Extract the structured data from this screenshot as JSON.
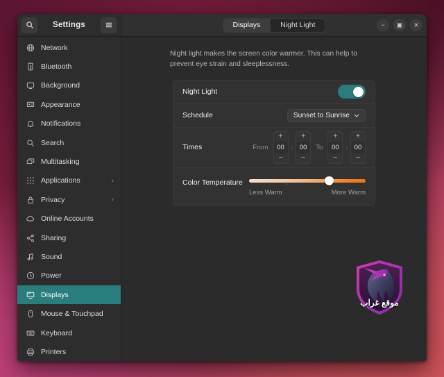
{
  "window": {
    "title": "Settings",
    "search_icon": "search-icon",
    "menu_icon": "hamburger-menu-icon",
    "controls": {
      "minimize": "−",
      "maximize": "▣",
      "close": "✕"
    }
  },
  "tabs": [
    {
      "label": "Displays",
      "active": true
    },
    {
      "label": "Night Light",
      "active": false
    }
  ],
  "sidebar": {
    "items": [
      {
        "label": "Network",
        "icon": "globe-icon",
        "active": false,
        "chevron": ""
      },
      {
        "label": "Bluetooth",
        "icon": "bluetooth-icon",
        "active": false,
        "chevron": ""
      },
      {
        "label": "Background",
        "icon": "monitor-icon",
        "active": false,
        "chevron": ""
      },
      {
        "label": "Appearance",
        "icon": "appearance-icon",
        "active": false,
        "chevron": ""
      },
      {
        "label": "Notifications",
        "icon": "bell-icon",
        "active": false,
        "chevron": ""
      },
      {
        "label": "Search",
        "icon": "magnifier-icon",
        "active": false,
        "chevron": ""
      },
      {
        "label": "Multitasking",
        "icon": "windows-icon",
        "active": false,
        "chevron": ""
      },
      {
        "label": "Applications",
        "icon": "grid-icon",
        "active": false,
        "chevron": "›"
      },
      {
        "label": "Privacy",
        "icon": "lock-icon",
        "active": false,
        "chevron": "›"
      },
      {
        "label": "Online Accounts",
        "icon": "cloud-icon",
        "active": false,
        "chevron": ""
      },
      {
        "label": "Sharing",
        "icon": "share-icon",
        "active": false,
        "chevron": ""
      },
      {
        "label": "Sound",
        "icon": "music-note-icon",
        "active": false,
        "chevron": ""
      },
      {
        "label": "Power",
        "icon": "power-icon",
        "active": false,
        "chevron": ""
      },
      {
        "label": "Displays",
        "icon": "display-icon",
        "active": true,
        "chevron": ""
      },
      {
        "label": "Mouse & Touchpad",
        "icon": "mouse-icon",
        "active": false,
        "chevron": ""
      },
      {
        "label": "Keyboard",
        "icon": "keyboard-icon",
        "active": false,
        "chevron": ""
      },
      {
        "label": "Printers",
        "icon": "printer-icon",
        "active": false,
        "chevron": ""
      }
    ]
  },
  "main": {
    "description": "Night light makes the screen color warmer. This can help to prevent eye strain and sleeplessness.",
    "night_light": {
      "label": "Night Light",
      "enabled": true
    },
    "schedule": {
      "label": "Schedule",
      "value": "Sunset to Sunrise",
      "chevron": "⌵"
    },
    "times": {
      "label": "Times",
      "from_label": "From",
      "to_label": "To",
      "separator": ":",
      "increment": "+",
      "decrement": "−",
      "from_hour": "00",
      "from_minute": "00",
      "to_hour": "00",
      "to_minute": "00"
    },
    "color_temperature": {
      "label": "Color Temperature",
      "min_label": "Less Warm",
      "max_label": "More Warm",
      "value_percent": 69,
      "tick_percent": 32
    }
  },
  "watermark": {
    "caption": "موقع غراب"
  },
  "colors": {
    "accent_teal": "#2a7d7d",
    "window_bg": "#2b2b2b",
    "sidebar_bg": "#2d2d2d",
    "card_bg": "#323232",
    "warm_end": "#ee7414"
  }
}
